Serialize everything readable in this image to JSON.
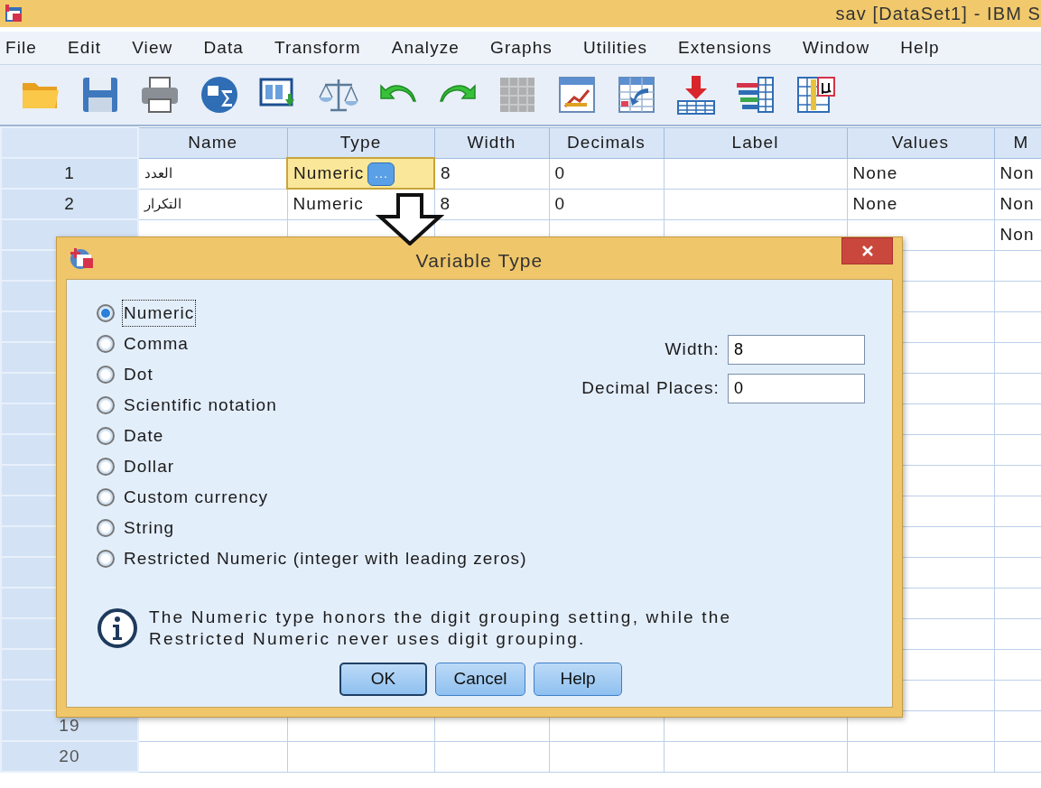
{
  "window": {
    "title": "sav [DataSet1] - IBM S"
  },
  "menu": [
    {
      "label": "File"
    },
    {
      "label": "Edit"
    },
    {
      "label": "View"
    },
    {
      "label": "Data"
    },
    {
      "label": "Transform"
    },
    {
      "label": "Analyze"
    },
    {
      "label": "Graphs"
    },
    {
      "label": "Utilities"
    },
    {
      "label": "Extensions"
    },
    {
      "label": "Window"
    },
    {
      "label": "Help"
    }
  ],
  "toolbar": [
    {
      "kind": "folder",
      "disabled": false
    },
    {
      "kind": "floppy",
      "disabled": false
    },
    {
      "kind": "printer",
      "disabled": false
    },
    {
      "kind": "sigma",
      "disabled": false
    },
    {
      "kind": "panel",
      "disabled": false
    },
    {
      "kind": "scale",
      "disabled": false
    },
    {
      "kind": "undo",
      "disabled": false
    },
    {
      "kind": "redo",
      "disabled": false
    },
    {
      "kind": "grid",
      "disabled": true
    },
    {
      "kind": "chart",
      "disabled": false
    },
    {
      "kind": "table-arrow",
      "disabled": false
    },
    {
      "kind": "download",
      "disabled": false
    },
    {
      "kind": "bars",
      "disabled": false
    },
    {
      "kind": "mu",
      "disabled": false
    }
  ],
  "grid": {
    "columns": [
      "Name",
      "Type",
      "Width",
      "Decimals",
      "Label",
      "Values",
      "M"
    ],
    "rows": [
      {
        "number": "1",
        "cells": [
          {
            "text": "العدد",
            "selected": false
          },
          {
            "text": "Numeric",
            "selected": true,
            "button": "..."
          },
          {
            "text": "8",
            "selected": false
          },
          {
            "text": "0",
            "selected": false
          },
          {
            "selected": false
          },
          {
            "text": "None",
            "selected": false
          },
          {
            "text": "Non",
            "selected": false
          }
        ]
      },
      {
        "number": "2",
        "cells": [
          {
            "text": "التكرار",
            "selected": false
          },
          {
            "text": "Numeric",
            "selected": false
          },
          {
            "text": "8",
            "selected": false
          },
          {
            "text": "0",
            "selected": false
          },
          {
            "selected": false
          },
          {
            "text": "None",
            "selected": false
          },
          {
            "text": "Non",
            "selected": false
          }
        ]
      },
      {
        "cells": [
          {
            "selected": false
          },
          {
            "selected": false
          },
          {
            "selected": false
          },
          {
            "selected": false
          },
          {
            "selected": false
          },
          {
            "selected": false
          },
          {
            "text": "Non",
            "selected": false
          }
        ]
      }
    ],
    "empty_rows": [
      "19",
      "20"
    ]
  },
  "dialog": {
    "title": "Variable Type",
    "options": [
      {
        "label": "Numeric",
        "selected": true,
        "focused": true
      },
      {
        "label": "Comma",
        "selected": false,
        "focused": false
      },
      {
        "label": "Dot",
        "selected": false,
        "focused": false
      },
      {
        "label": "Scientific notation",
        "selected": false,
        "focused": false
      },
      {
        "label": "Date",
        "selected": false,
        "focused": false
      },
      {
        "label": "Dollar",
        "selected": false,
        "focused": false
      },
      {
        "label": "Custom currency",
        "selected": false,
        "focused": false
      },
      {
        "label": "String",
        "selected": false,
        "focused": false
      },
      {
        "label": "Restricted Numeric (integer with leading zeros)",
        "selected": false,
        "focused": false
      }
    ],
    "fields": [
      {
        "label": "Width:",
        "value": "8"
      },
      {
        "label": "Decimal Places:",
        "value": "0"
      }
    ],
    "info": "The Numeric type honors the digit grouping setting, while the Restricted Numeric never uses digit grouping.",
    "buttons": [
      {
        "label": "OK",
        "default": true
      },
      {
        "label": "Cancel",
        "default": false
      },
      {
        "label": "Help",
        "default": false
      }
    ]
  }
}
